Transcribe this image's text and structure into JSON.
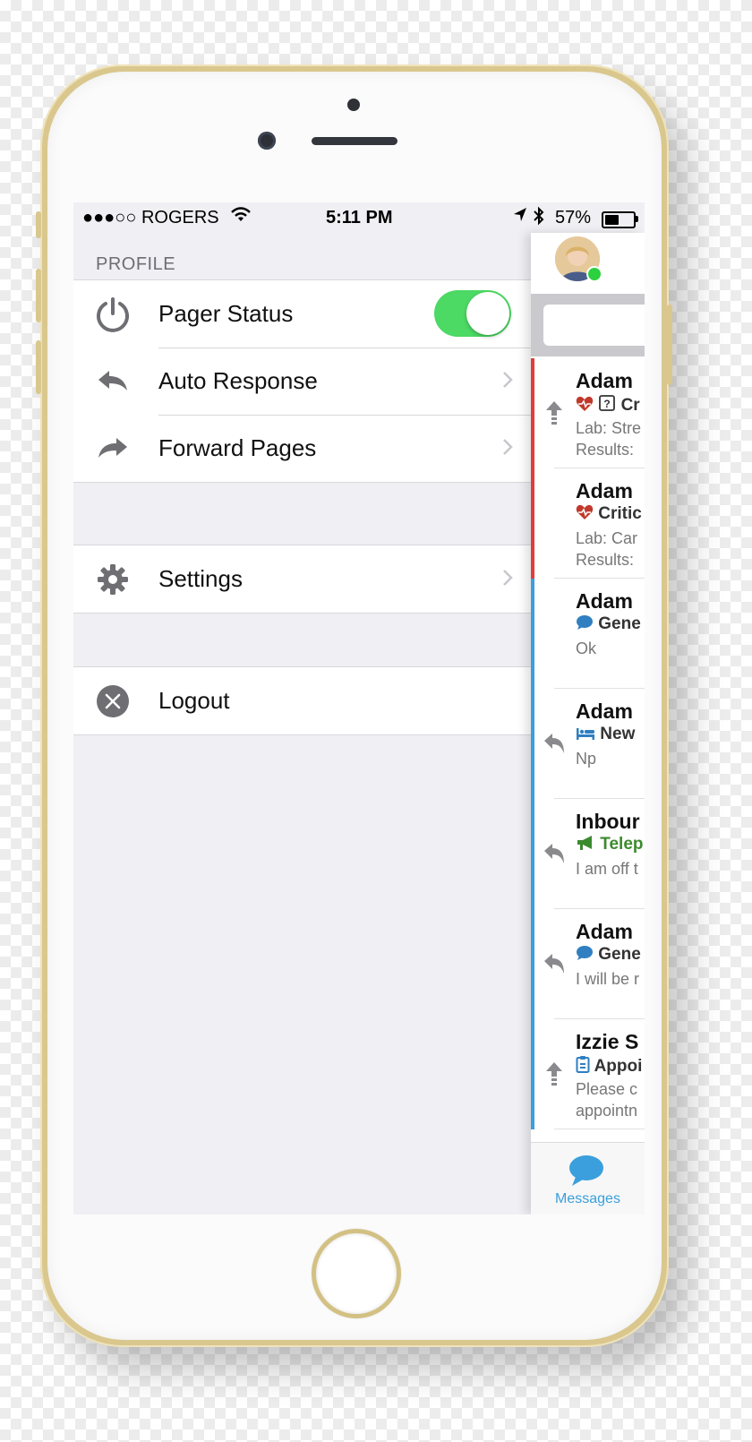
{
  "status_bar": {
    "carrier": "●●●○○ ROGERS",
    "time": "5:11 PM",
    "battery_text": "57%",
    "battery_level": 0.57
  },
  "drawer": {
    "section_title": "PROFILE",
    "pager_status": {
      "label": "Pager Status",
      "enabled": true,
      "icon": "power-icon"
    },
    "auto_response": {
      "label": "Auto Response",
      "icon": "reply-icon"
    },
    "forward_pages": {
      "label": "Forward Pages",
      "icon": "forward-icon"
    },
    "settings": {
      "label": "Settings",
      "icon": "gear-icon"
    },
    "logout": {
      "label": "Logout",
      "icon": "close-circle-icon"
    }
  },
  "messages": {
    "items": [
      {
        "name": "Adam",
        "category": "Cr",
        "body": "Lab: Stre\nResults:",
        "bar": "red",
        "icon": "up-arrow-icon",
        "category_icon": "heartbeat-question-icon"
      },
      {
        "name": "Adam",
        "category": "Critic",
        "body": "Lab: Car\nResults:",
        "bar": "red",
        "icon": "",
        "category_icon": "heartbeat-icon"
      },
      {
        "name": "Adam",
        "category": "Gene",
        "body": "Ok",
        "bar": "blue",
        "icon": "",
        "category_icon": "speech-bubble-icon"
      },
      {
        "name": "Adam",
        "category": "New",
        "body": "Np",
        "bar": "blue",
        "icon": "reply-icon",
        "category_icon": "bed-icon"
      },
      {
        "name": "Inbour",
        "category": "Telep",
        "body": "I am off t",
        "bar": "blue",
        "icon": "reply-icon",
        "category_icon": "megaphone-icon"
      },
      {
        "name": "Adam",
        "category": "Gene",
        "body": "I will be r",
        "bar": "blue",
        "icon": "reply-icon",
        "category_icon": "speech-bubble-icon"
      },
      {
        "name": "Izzie S",
        "category": "Appoi",
        "body": "Please c\nappointn",
        "bar": "blue",
        "icon": "up-arrow-icon",
        "category_icon": "clipboard-icon"
      }
    ],
    "tab_label": "Messages"
  },
  "colors": {
    "toggle_on": "#4cd964",
    "urgent_bar": "#e03c3c",
    "normal_bar": "#3a9fdc",
    "heartbeat": "#c0392b",
    "speech": "#2f7fc1",
    "megaphone": "#3c8a2e"
  }
}
